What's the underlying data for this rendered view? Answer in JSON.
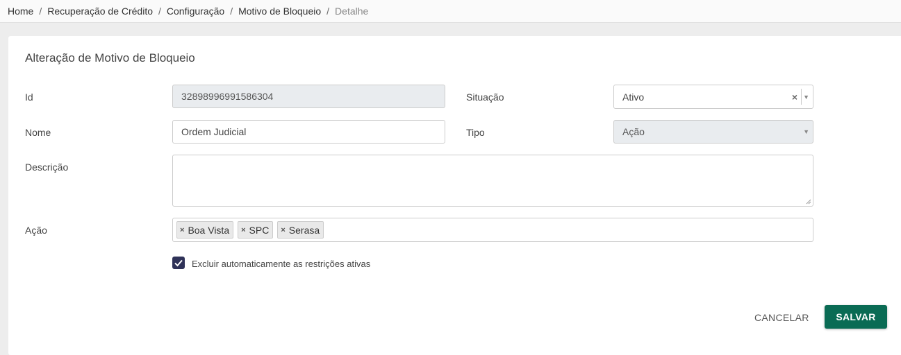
{
  "breadcrumb": {
    "items": [
      "Home",
      "Recuperação de Crédito",
      "Configuração",
      "Motivo de Bloqueio",
      "Detalhe"
    ],
    "separator": "/"
  },
  "form": {
    "title": "Alteração de Motivo de Bloqueio",
    "id": {
      "label": "Id",
      "value": "32898996991586304"
    },
    "situacao": {
      "label": "Situação",
      "value": "Ativo",
      "clear_icon": "×",
      "arrow_icon": "▼"
    },
    "nome": {
      "label": "Nome",
      "value": "Ordem Judicial"
    },
    "tipo": {
      "label": "Tipo",
      "value": "Ação",
      "arrow_icon": "▼"
    },
    "descricao": {
      "label": "Descrição",
      "value": ""
    },
    "acao": {
      "label": "Ação",
      "remove_icon": "×",
      "tags": [
        "Boa Vista",
        "SPC",
        "Serasa"
      ]
    },
    "excluir": {
      "label": "Excluir automaticamente as restrições ativas",
      "checked": true
    }
  },
  "actions": {
    "cancel_label": "CANCELAR",
    "save_label": "SALVAR"
  },
  "colors": {
    "primary": "#0a6b54",
    "checkbox": "#2f3258",
    "disabled_bg": "#e9ecef"
  }
}
